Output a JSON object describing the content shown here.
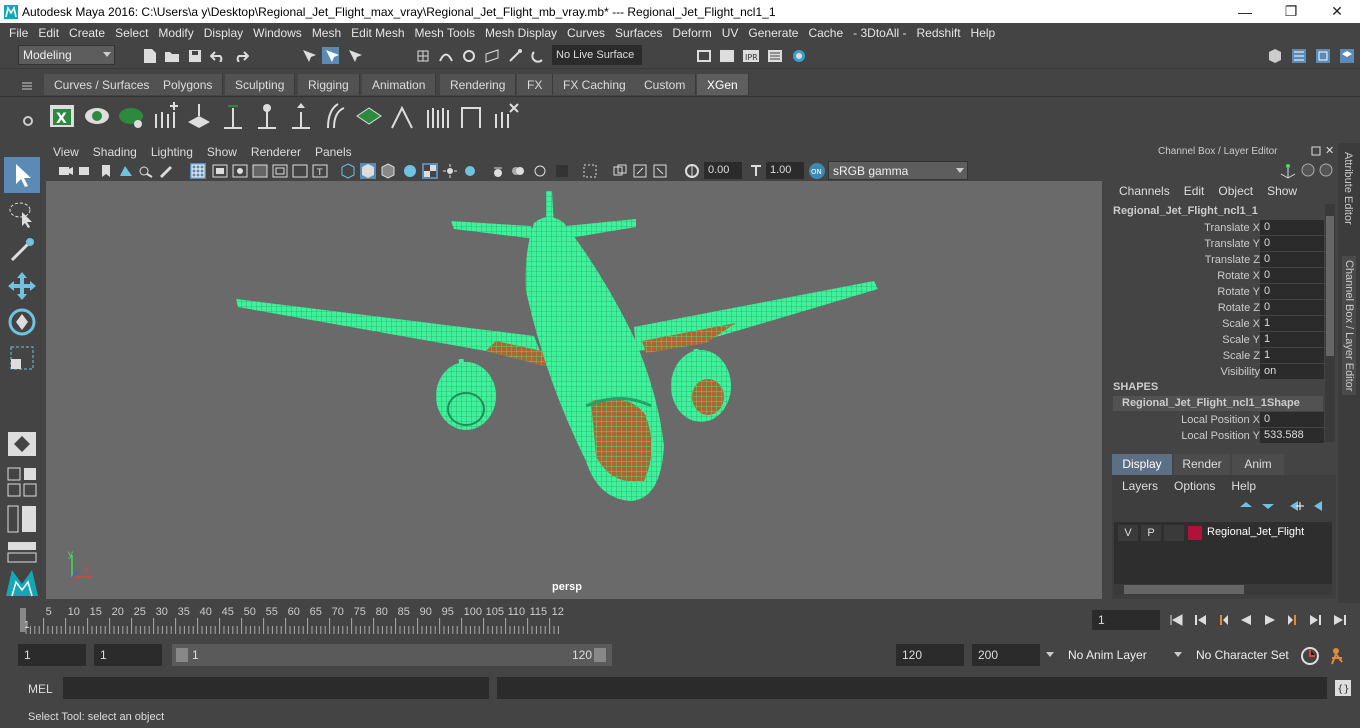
{
  "window": {
    "title": "Autodesk Maya 2016: C:\\Users\\a y\\Desktop\\Regional_Jet_Flight_max_vray\\Regional_Jet_Flight_mb_vray.mb*   ---   Regional_Jet_Flight_ncl1_1",
    "minimize": "—",
    "maximize": "❐",
    "close": "✕"
  },
  "menu": [
    "File",
    "Edit",
    "Create",
    "Select",
    "Modify",
    "Display",
    "Windows",
    "Mesh",
    "Edit Mesh",
    "Mesh Tools",
    "Mesh Display",
    "Curves",
    "Surfaces",
    "Deform",
    "UV",
    "Generate",
    "Cache",
    "- 3DtoAll -",
    "Redshift",
    "Help"
  ],
  "statusline": {
    "mode": "Modeling",
    "live_surface": "No Live Surface"
  },
  "shelf": {
    "tabs": [
      "Curves / Surfaces",
      "Polygons",
      "Sculpting",
      "Rigging",
      "Animation",
      "Rendering",
      "FX",
      "FX Caching",
      "Custom",
      "XGen"
    ],
    "active_tab": "XGen"
  },
  "viewport": {
    "menu": [
      "View",
      "Shading",
      "Lighting",
      "Show",
      "Renderer",
      "Panels"
    ],
    "exposure": "0.00",
    "gamma": "1.00",
    "color_space": "sRGB gamma",
    "camera_label": "persp",
    "axis_y": "y",
    "axis_x": "x",
    "colors": {
      "wire": "#3ef19a",
      "underside": "#b0652f"
    }
  },
  "channelbox": {
    "header": "Channel Box / Layer Editor",
    "menu": [
      "Channels",
      "Edit",
      "Object",
      "Show"
    ],
    "object_name": "Regional_Jet_Flight_ncl1_1",
    "attributes": [
      {
        "label": "Translate X",
        "value": "0"
      },
      {
        "label": "Translate Y",
        "value": "0"
      },
      {
        "label": "Translate Z",
        "value": "0"
      },
      {
        "label": "Rotate X",
        "value": "0"
      },
      {
        "label": "Rotate Y",
        "value": "0"
      },
      {
        "label": "Rotate Z",
        "value": "0"
      },
      {
        "label": "Scale X",
        "value": "1"
      },
      {
        "label": "Scale Y",
        "value": "1"
      },
      {
        "label": "Scale Z",
        "value": "1"
      },
      {
        "label": "Visibility",
        "value": "on"
      }
    ],
    "shapes_header": "SHAPES",
    "shape_name": "Regional_Jet_Flight_ncl1_1Shape",
    "shape_attributes": [
      {
        "label": "Local Position X",
        "value": "0"
      },
      {
        "label": "Local Position Y",
        "value": "533.588"
      }
    ],
    "layer_tabs": [
      "Display",
      "Render",
      "Anim"
    ],
    "layer_menu": [
      "Layers",
      "Options",
      "Help"
    ],
    "layer": {
      "v": "V",
      "p": "P",
      "name": "Regional_Jet_Flight",
      "color": "#b0123a"
    }
  },
  "side_tabs": [
    "Attribute Editor",
    "Channel Box / Layer Editor"
  ],
  "timeline": {
    "ticks": [
      "5",
      "10",
      "15",
      "20",
      "25",
      "30",
      "35",
      "40",
      "45",
      "50",
      "55",
      "60",
      "65",
      "70",
      "75",
      "80",
      "85",
      "90",
      "95",
      "100",
      "105",
      "110",
      "115",
      "12"
    ],
    "start_marker": "1",
    "current_frame": "1"
  },
  "range": {
    "start": "1",
    "playback_start": "1",
    "slider_start": "1",
    "slider_end": "120",
    "playback_end": "120",
    "end": "200",
    "anim_layer": "No Anim Layer",
    "character_set": "No Character Set"
  },
  "mel": {
    "label": "MEL"
  },
  "help_line": "Select Tool: select an object"
}
